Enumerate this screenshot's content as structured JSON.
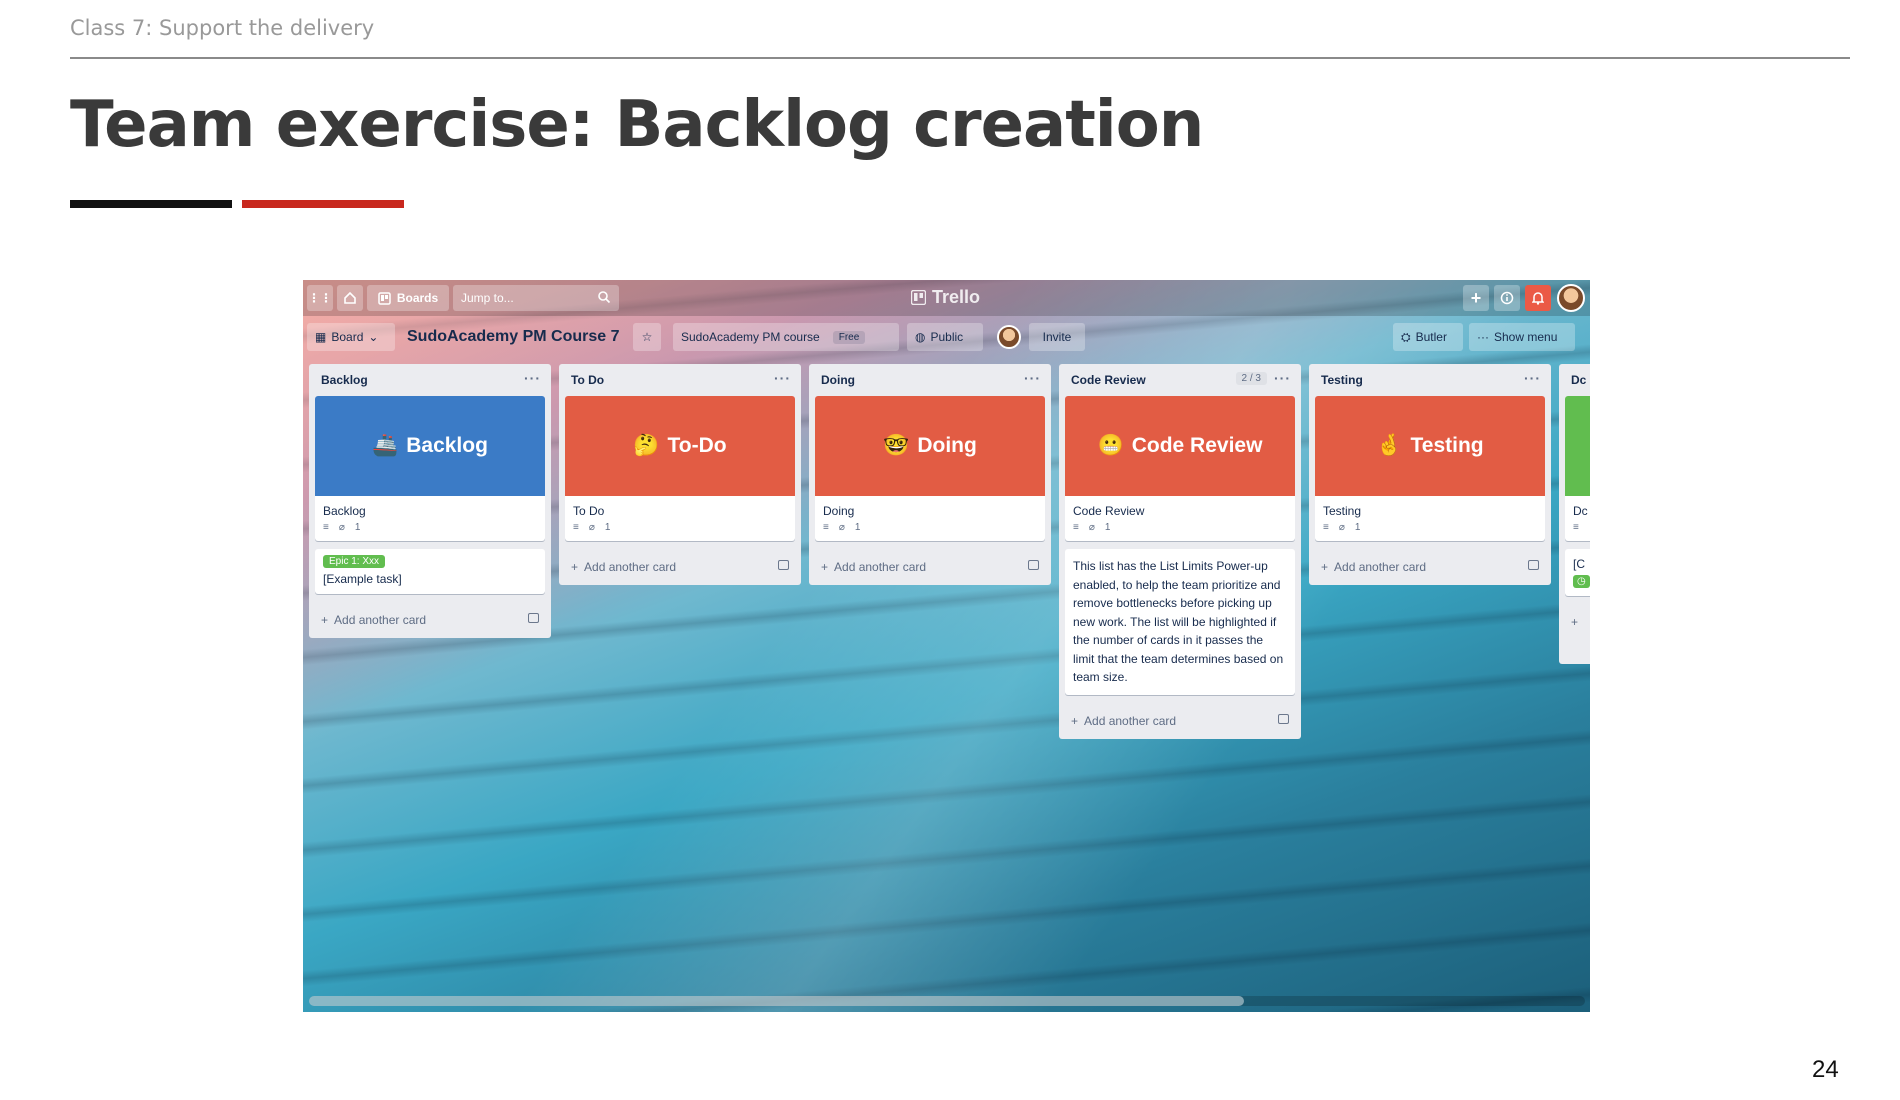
{
  "slide": {
    "header": "Class 7: Support the delivery",
    "title": "Team exercise: Backlog creation",
    "page_number": "24"
  },
  "trello": {
    "topbar": {
      "boards_label": "Boards",
      "search_placeholder": "Jump to...",
      "logo_text": "Trello"
    },
    "boardbar": {
      "board_menu_label": "Board",
      "board_name": "SudoAcademy PM Course 7",
      "team_name": "SudoAcademy PM course",
      "team_badge": "Free",
      "visibility_label": "Public",
      "invite_label": "Invite",
      "butler_label": "Butler",
      "show_menu_label": "Show menu"
    },
    "lists": [
      {
        "name": "Backlog",
        "cover_text": "Backlog",
        "cover_emoji": "🚢",
        "cover_color": "#3b7bc6",
        "card_title": "Backlog",
        "attachments": "1",
        "extra_card": {
          "label": "Epic 1: Xxx",
          "title": "[Example task]"
        },
        "add_card_label": "Add another card"
      },
      {
        "name": "To Do",
        "cover_text": "To-Do",
        "cover_emoji": "🤔",
        "cover_color": "#e25c44",
        "card_title": "To Do",
        "attachments": "1",
        "add_card_label": "Add another card"
      },
      {
        "name": "Doing",
        "cover_text": "Doing",
        "cover_emoji": "🤓",
        "cover_color": "#e25c44",
        "card_title": "Doing",
        "attachments": "1",
        "add_card_label": "Add another card"
      },
      {
        "name": "Code Review",
        "limit": "2 / 3",
        "cover_text": "Code Review",
        "cover_emoji": "😬",
        "cover_color": "#e25c44",
        "card_title": "Code Review",
        "attachments": "1",
        "description": "This list has the List Limits Power-up enabled, to help the team prioritize and remove bottlenecks before picking up new work. The list will be highlighted if the number of cards in it passes the limit that the team determines based on team size.",
        "add_card_label": "Add another card"
      },
      {
        "name": "Testing",
        "cover_text": "Testing",
        "cover_emoji": "🤞",
        "cover_color": "#e25c44",
        "card_title": "Testing",
        "attachments": "1",
        "add_card_label": "Add another card"
      },
      {
        "name": "Dc",
        "cover_color": "#61bd4f",
        "card_title": "Dc",
        "extra_card_title": "[C"
      }
    ]
  },
  "colors": {
    "title_text": "#3a3a3a",
    "accent_black": "#111111",
    "accent_red": "#c8281e",
    "notification": "#eb5a46"
  }
}
